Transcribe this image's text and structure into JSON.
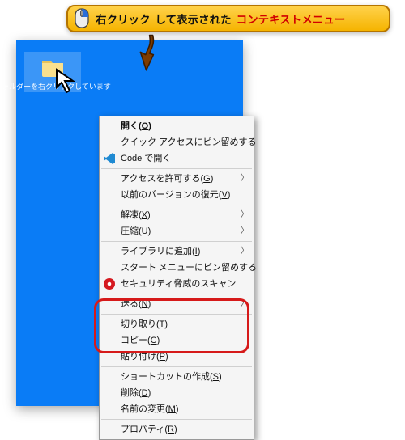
{
  "callout": {
    "text_black_1": "右クリック",
    "text_black_2": "して表示された",
    "text_red": "コンテキストメニュー"
  },
  "folder": {
    "label": "フォルダーを右クリックしています"
  },
  "menu": {
    "open": "開く(O)",
    "pin_quick": "クイック アクセスにピン留めする",
    "code": "Code で開く",
    "grant_access": "アクセスを許可する(G)",
    "restore_prev": "以前のバージョンの復元(V)",
    "extract": "解凍(X)",
    "compress": "圧縮(U)",
    "add_library": "ライブラリに追加(I)",
    "pin_start": "スタート メニューにピン留めする",
    "sec_scan": "セキュリティ脅威のスキャン",
    "send_to": "送る(N)",
    "cut": "切り取り(T)",
    "copy": "コピー(C)",
    "paste": "貼り付け(P)",
    "shortcut": "ショートカットの作成(S)",
    "delete": "削除(D)",
    "rename": "名前の変更(M)",
    "properties": "プロパティ(R)"
  }
}
